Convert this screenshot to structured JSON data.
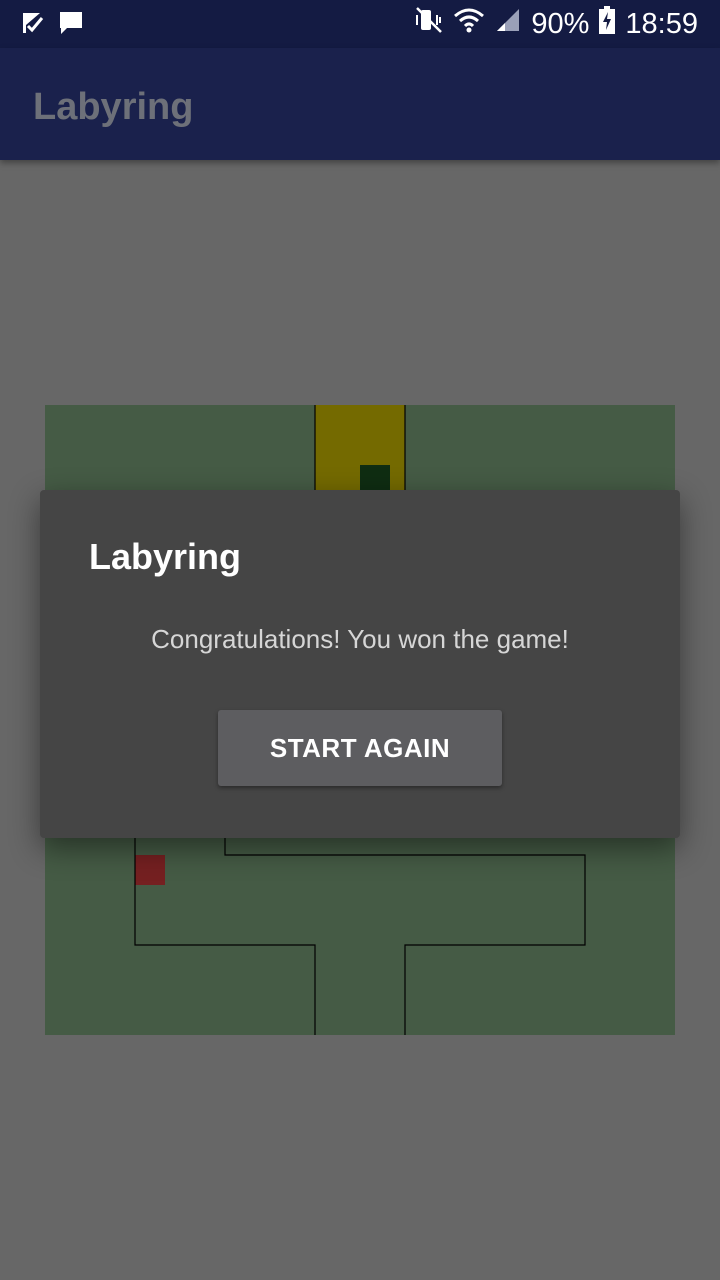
{
  "status_bar": {
    "battery": "90%",
    "time": "18:59",
    "icons": [
      "flag-check-icon",
      "chat-bubble-icon",
      "mute-vibrate-icon",
      "wifi-icon",
      "signal-icon",
      "battery-charging-icon"
    ]
  },
  "app_bar": {
    "title": "Labyring"
  },
  "maze": {
    "background_color": "#455b45",
    "wall_color": "#000000",
    "goal_color": "#746a00",
    "player_color": "#0f2d12",
    "start_marker_color": "#752021"
  },
  "dialog": {
    "title": "Labyring",
    "message": "Congratulations! You won the game!",
    "button_label": "START AGAIN"
  }
}
